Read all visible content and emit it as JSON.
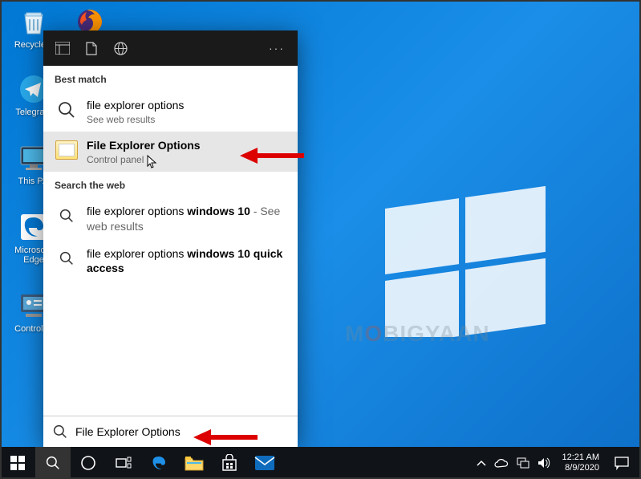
{
  "desktop": {
    "icons": [
      {
        "label": "Recycle...",
        "glyph": "recycle-bin"
      },
      {
        "label": "Telegra...",
        "glyph": "telegram"
      },
      {
        "label": "This P...",
        "glyph": "this-pc"
      },
      {
        "label": "Microso... Edge",
        "glyph": "edge"
      },
      {
        "label": "Control ...",
        "glyph": "control-panel"
      }
    ],
    "firefox_label": ""
  },
  "search_panel": {
    "section_best_match": "Best match",
    "section_search_web": "Search the web",
    "results": {
      "web_primary": {
        "title": "file explorer options",
        "sub": "See web results"
      },
      "highlighted": {
        "title": "File Explorer Options",
        "sub": "Control panel"
      },
      "web1": {
        "prefix": "file explorer options ",
        "bold": "windows 10",
        "suffix": " - See web results"
      },
      "web2": {
        "prefix": "file explorer options ",
        "bold": "windows 10 quick access",
        "suffix": ""
      }
    },
    "input_value": "File Explorer Options"
  },
  "watermark": "M BIGYAAN",
  "taskbar": {
    "clock_time": "12:21 AM",
    "clock_date": "8/9/2020"
  }
}
